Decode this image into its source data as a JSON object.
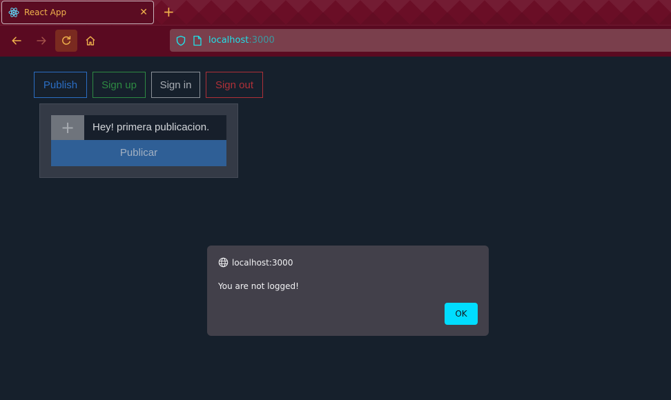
{
  "browser": {
    "tab_title": "React App",
    "tab_close": "✕",
    "new_tab": "+",
    "url_host": "localhost",
    "url_port": ":3000"
  },
  "icons": {
    "tab": "react-logo-icon",
    "back": "arrow-left-icon",
    "forward": "arrow-right-icon",
    "reload": "reload-icon",
    "home": "home-icon",
    "security": "shield-icon",
    "page": "page-icon",
    "dialog_origin": "globe-icon"
  },
  "nav": {
    "publish": "Publish",
    "signup": "Sign up",
    "signin": "Sign in",
    "signout": "Sign out"
  },
  "composer": {
    "plus": "+",
    "input_value": "Hey! primera publicacion.",
    "submit": "Publicar"
  },
  "dialog": {
    "origin": "localhost:3000",
    "message": "You are not logged!",
    "ok": "OK"
  },
  "colors": {
    "accent_orange": "#f0b24c",
    "url_cyan": "#20e0e8",
    "ok_button": "#00ddff",
    "publish_blue": "#2b6ec4",
    "signup_green": "#2e8a43",
    "signout_red": "#b03038"
  }
}
